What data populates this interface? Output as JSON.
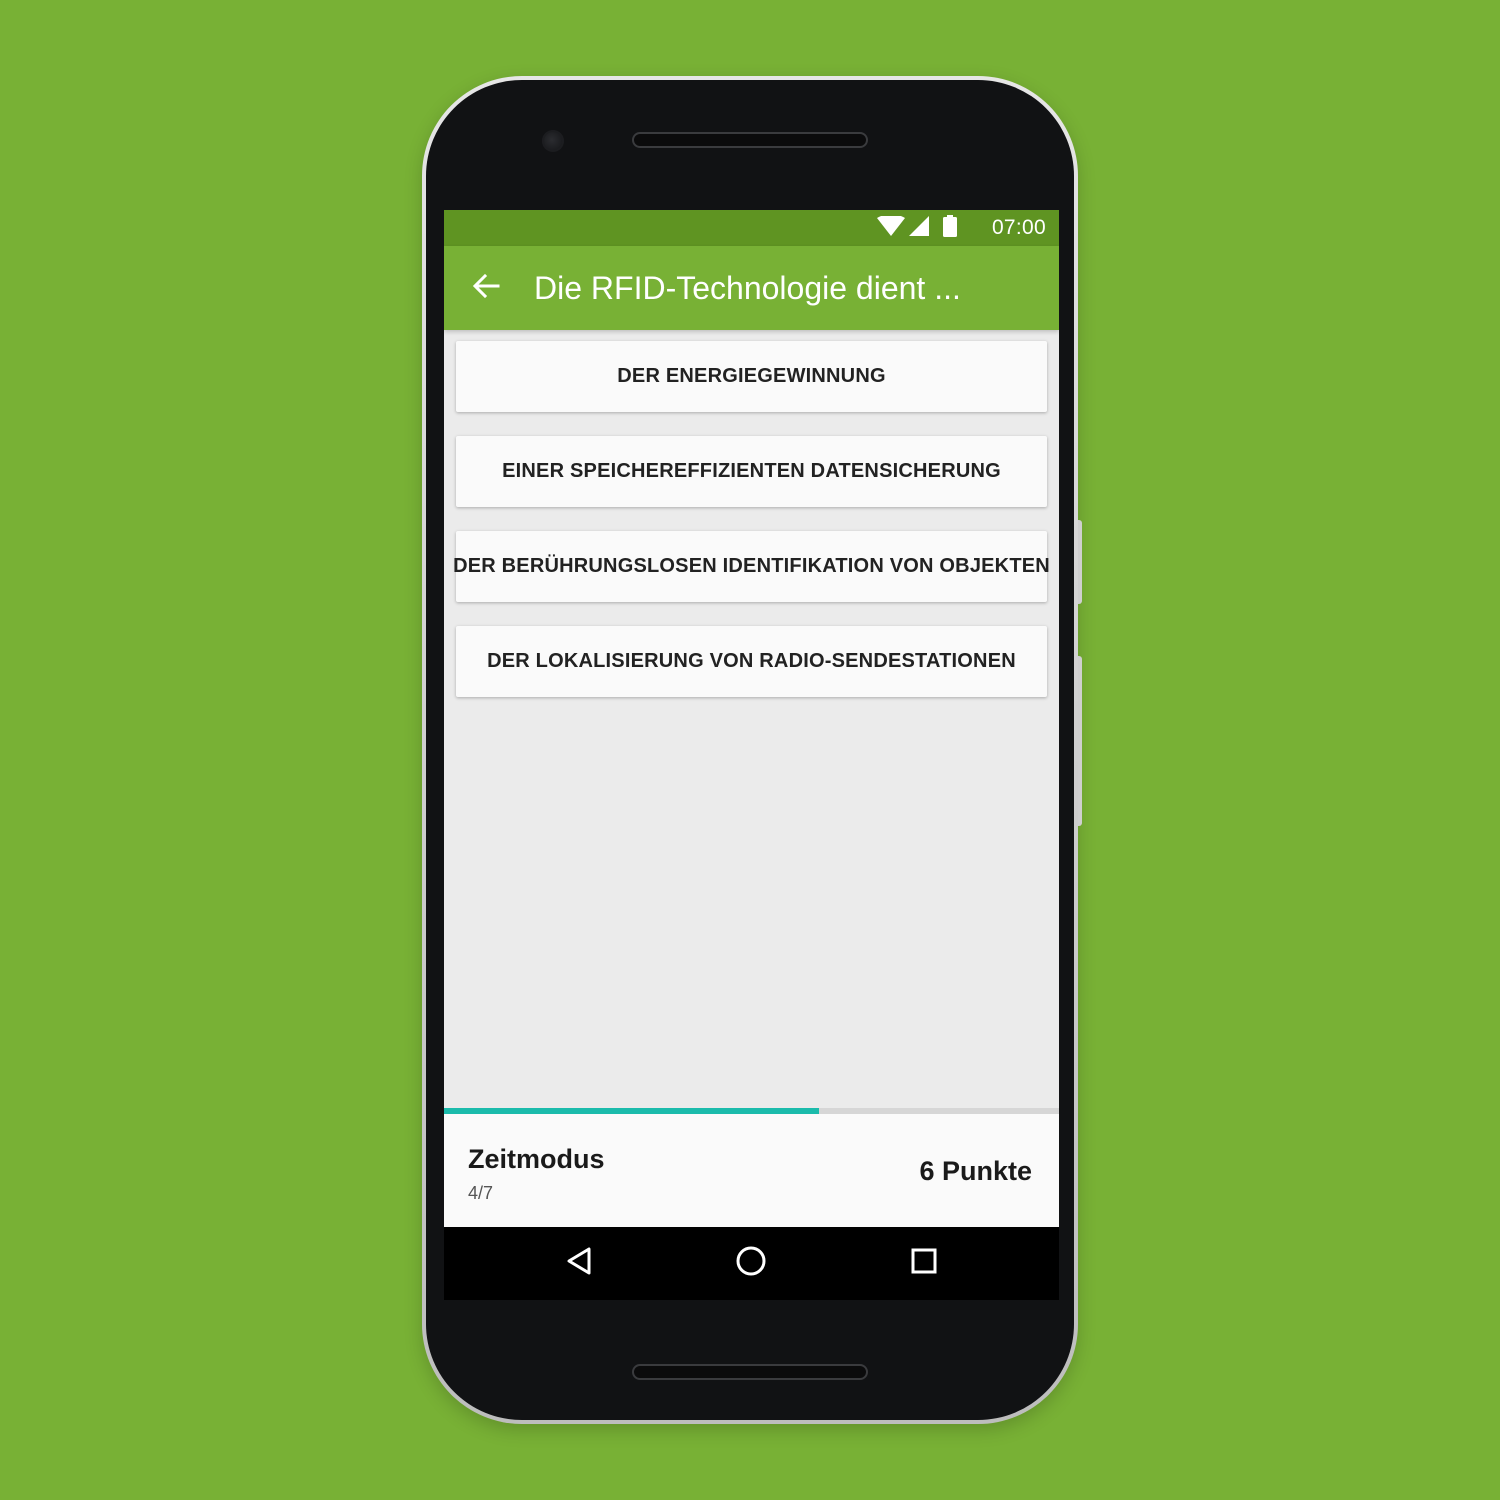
{
  "status_bar": {
    "time": "07:00",
    "icons": [
      "wifi-icon",
      "signal-icon",
      "battery-icon"
    ]
  },
  "app_bar": {
    "back_icon": "arrow-left-icon",
    "title": "Die RFID-Technologie dient ..."
  },
  "answers": [
    {
      "label": "DER ENERGIEGEWINNUNG"
    },
    {
      "label": "EINER SPEICHEREFFIZIENTEN DATENSICHERUNG"
    },
    {
      "label": "DER BERÜHRUNGSLOSEN IDENTIFIKATION VON OBJEKTEN"
    },
    {
      "label": "DER LOKALISIERUNG VON RADIO-SENDESTATIONEN"
    }
  ],
  "progress": {
    "fraction": 0.61
  },
  "footer": {
    "mode": "Zeitmodus",
    "question_counter": "4/7",
    "score": "6 Punkte"
  },
  "nav_bar": {
    "icons": [
      "back-triangle-icon",
      "home-circle-icon",
      "recents-square-icon"
    ]
  },
  "colors": {
    "background": "#78b135",
    "app_bar": "#78b135",
    "status_bar": "#5f9422",
    "progress": "#1bbbab",
    "content_background": "#ebebeb"
  }
}
